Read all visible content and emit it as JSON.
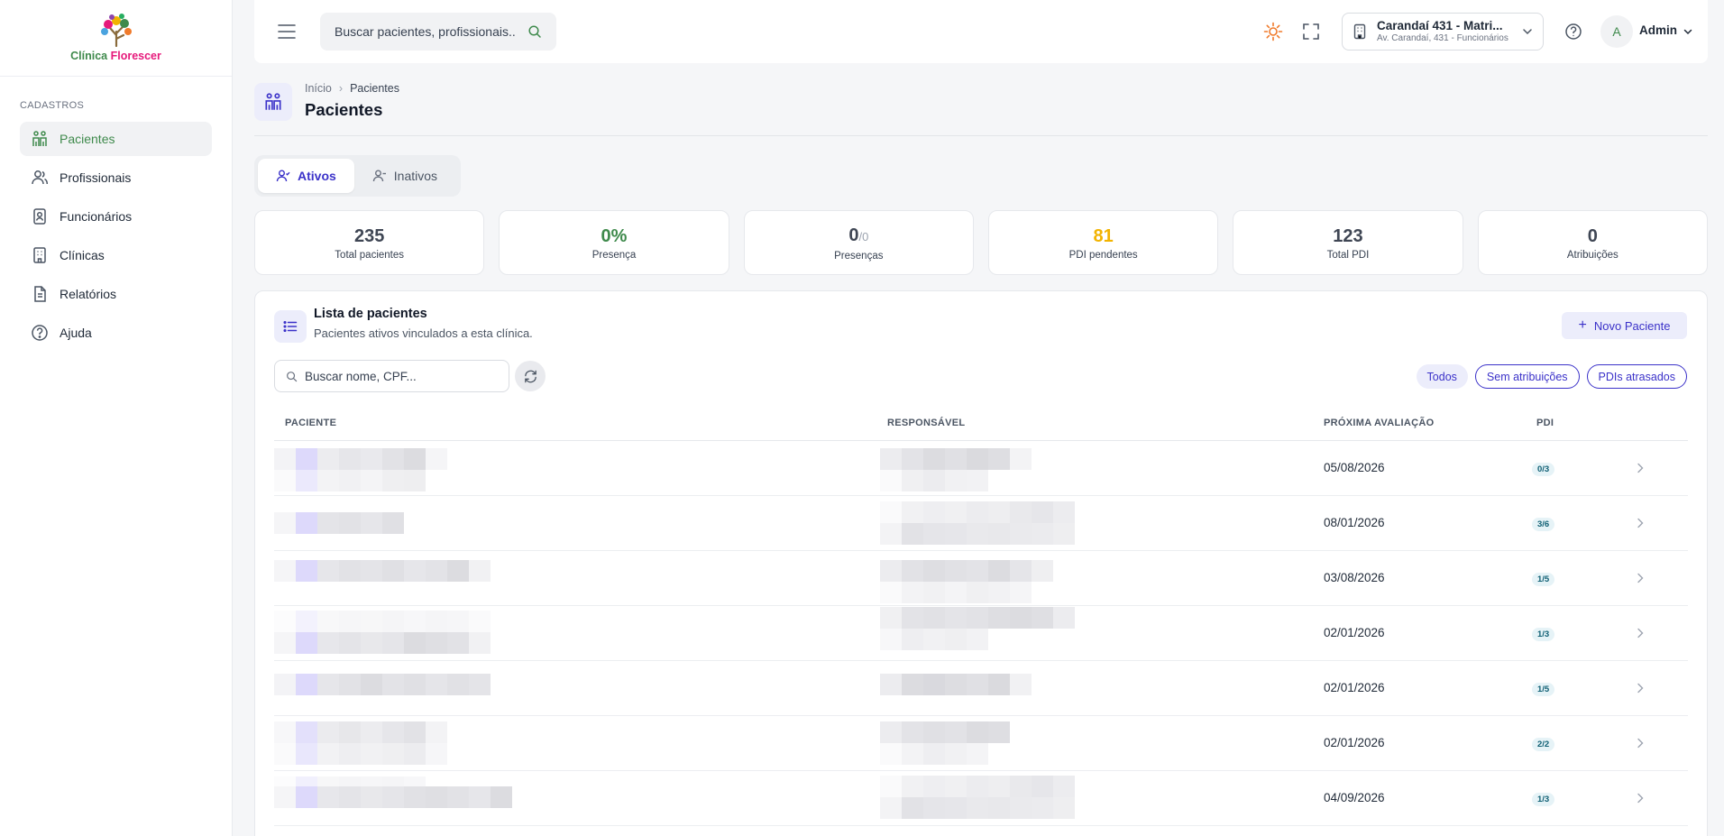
{
  "app": {
    "logo_text_part1": "Clínica ",
    "logo_text_part2": "Florescer",
    "colors": {
      "brand_green": "#3f8a4c",
      "brand_pink": "#e6197b",
      "accent": "#3b32c9",
      "warning": "#f2b300"
    }
  },
  "sidebar": {
    "section": "CADASTROS",
    "items": [
      {
        "label": "Pacientes",
        "icon": "patients-icon",
        "active": true
      },
      {
        "label": "Profissionais",
        "icon": "users-icon"
      },
      {
        "label": "Funcionários",
        "icon": "badge-icon"
      },
      {
        "label": "Clínicas",
        "icon": "building-icon"
      },
      {
        "label": "Relatórios",
        "icon": "report-icon"
      },
      {
        "label": "Ajuda",
        "icon": "help-icon"
      }
    ]
  },
  "topbar": {
    "search_placeholder": "Buscar pacientes, profissionais...",
    "clinic_name": "Carandaí 431 - Matri...",
    "clinic_address": "Av. Carandaí, 431 - Funcionários",
    "user_initial": "A",
    "user_name": "Admin"
  },
  "page": {
    "breadcrumb_home": "Início",
    "breadcrumb_current": "Pacientes",
    "title": "Pacientes"
  },
  "tabs": [
    {
      "label": "Ativos",
      "active": true
    },
    {
      "label": "Inativos"
    }
  ],
  "stats": [
    {
      "value": "235",
      "label": "Total pacientes",
      "color": "#3f4654"
    },
    {
      "value": "0%",
      "label": "Presença",
      "color": "#3f8a4c"
    },
    {
      "value": "0",
      "sub": "/0",
      "label": "Presenças",
      "color": "#3f4654"
    },
    {
      "value": "81",
      "label": "PDI pendentes",
      "color": "#f2b300"
    },
    {
      "value": "123",
      "label": "Total PDI",
      "color": "#3f4654"
    },
    {
      "value": "0",
      "label": "Atribuições",
      "color": "#3f4654"
    }
  ],
  "list": {
    "title": "Lista de pacientes",
    "subtitle": "Pacientes ativos vinculados a esta clínica.",
    "new_button": "Novo Paciente",
    "search_placeholder": "Buscar nome, CPF...",
    "filters": [
      "Todos",
      "Sem atribuições",
      "PDIs atrasados"
    ],
    "columns": {
      "patient": "PACIENTE",
      "responsible": "RESPONSÁVEL",
      "next_eval": "PRÓXIMA AVALIAÇÃO",
      "pdi": "PDI"
    },
    "rows": [
      {
        "next_eval": "05/08/2026",
        "pdi": "0/3"
      },
      {
        "next_eval": "08/01/2026",
        "pdi": "3/6"
      },
      {
        "next_eval": "03/08/2026",
        "pdi": "1/5"
      },
      {
        "next_eval": "02/01/2026",
        "pdi": "1/3"
      },
      {
        "next_eval": "02/01/2026",
        "pdi": "1/5"
      },
      {
        "next_eval": "02/01/2026",
        "pdi": "2/2"
      },
      {
        "next_eval": "04/09/2026",
        "pdi": "1/3"
      }
    ]
  }
}
